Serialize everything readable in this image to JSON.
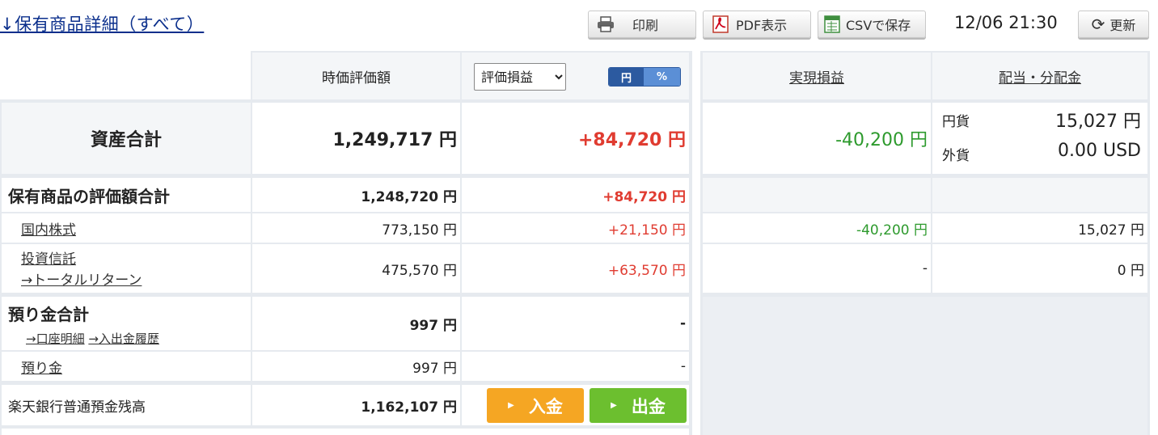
{
  "header": {
    "title": "↓保有商品詳細（すべて）",
    "print_label": "印刷",
    "pdf_label": "PDF表示",
    "csv_label": "CSVで保存",
    "datetime": "12/06 21:30",
    "refresh_label": "更新"
  },
  "columns": {
    "market_value": "時価評価額",
    "pl_select": "評価損益",
    "toggle_yen": "円",
    "toggle_pct": "%",
    "realized": "実現損益",
    "dividends": "配当・分配金"
  },
  "total_assets": {
    "label": "資産合計",
    "market_value": "1,249,717 円",
    "pl": "+84,720 円",
    "realized": "-40,200 円",
    "dividend_jpy_label": "円貨",
    "dividend_jpy": "15,027 円",
    "dividend_fx_label": "外貨",
    "dividend_fx": "0.00 USD"
  },
  "holdings_total": {
    "label": "保有商品の評価額合計",
    "market_value": "1,248,720 円",
    "pl": "+84,720 円"
  },
  "domestic_stocks": {
    "label": "国内株式",
    "market_value": "773,150 円",
    "pl": "+21,150 円",
    "realized": "-40,200 円",
    "dividend": "15,027 円"
  },
  "investment_trusts": {
    "label": "投資信託",
    "sublink": "→トータルリターン",
    "market_value": "475,570 円",
    "pl": "+63,570 円",
    "realized": "-",
    "dividend": "0 円"
  },
  "deposits_total": {
    "label": "預り金合計",
    "link_account": "→口座明細",
    "link_history": "→入出金履歴",
    "market_value": "997 円",
    "pl": "-"
  },
  "deposits": {
    "label": "預り金",
    "market_value": "997 円",
    "pl": "-"
  },
  "bank_balance": {
    "label": "楽天銀行普通預金残高",
    "market_value": "1,162,107 円",
    "deposit_button": "入金",
    "withdraw_button": "出金"
  },
  "colors": {
    "positive": "#e03c31",
    "negative": "#2d9a2d",
    "deposit_button": "#f5a623",
    "withdraw_button": "#6cbf2f",
    "toggle_active": "#2c5aa0",
    "toggle_inactive": "#5b8fd6"
  }
}
